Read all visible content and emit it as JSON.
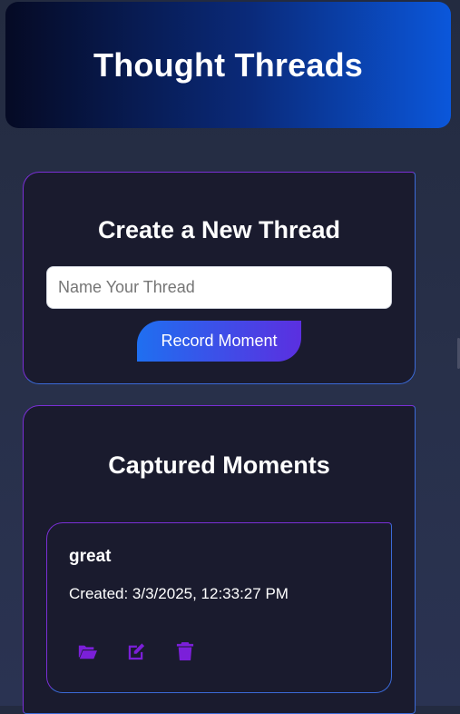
{
  "header": {
    "title": "Thought Threads"
  },
  "create": {
    "heading": "Create a New Thread",
    "input_placeholder": "Name Your Thread",
    "input_value": "",
    "button_label": "Record Moment"
  },
  "moments": {
    "heading": "Captured Moments",
    "items": [
      {
        "title": "great",
        "created": "Created: 3/3/2025, 12:33:27 PM",
        "actions": [
          "folder-open-icon",
          "edit-icon",
          "trash-icon"
        ]
      }
    ]
  },
  "colors": {
    "accent_purple": "#7b1fd9",
    "accent_blue": "#1f6ff0",
    "card_bg": "#1a1b2e"
  }
}
